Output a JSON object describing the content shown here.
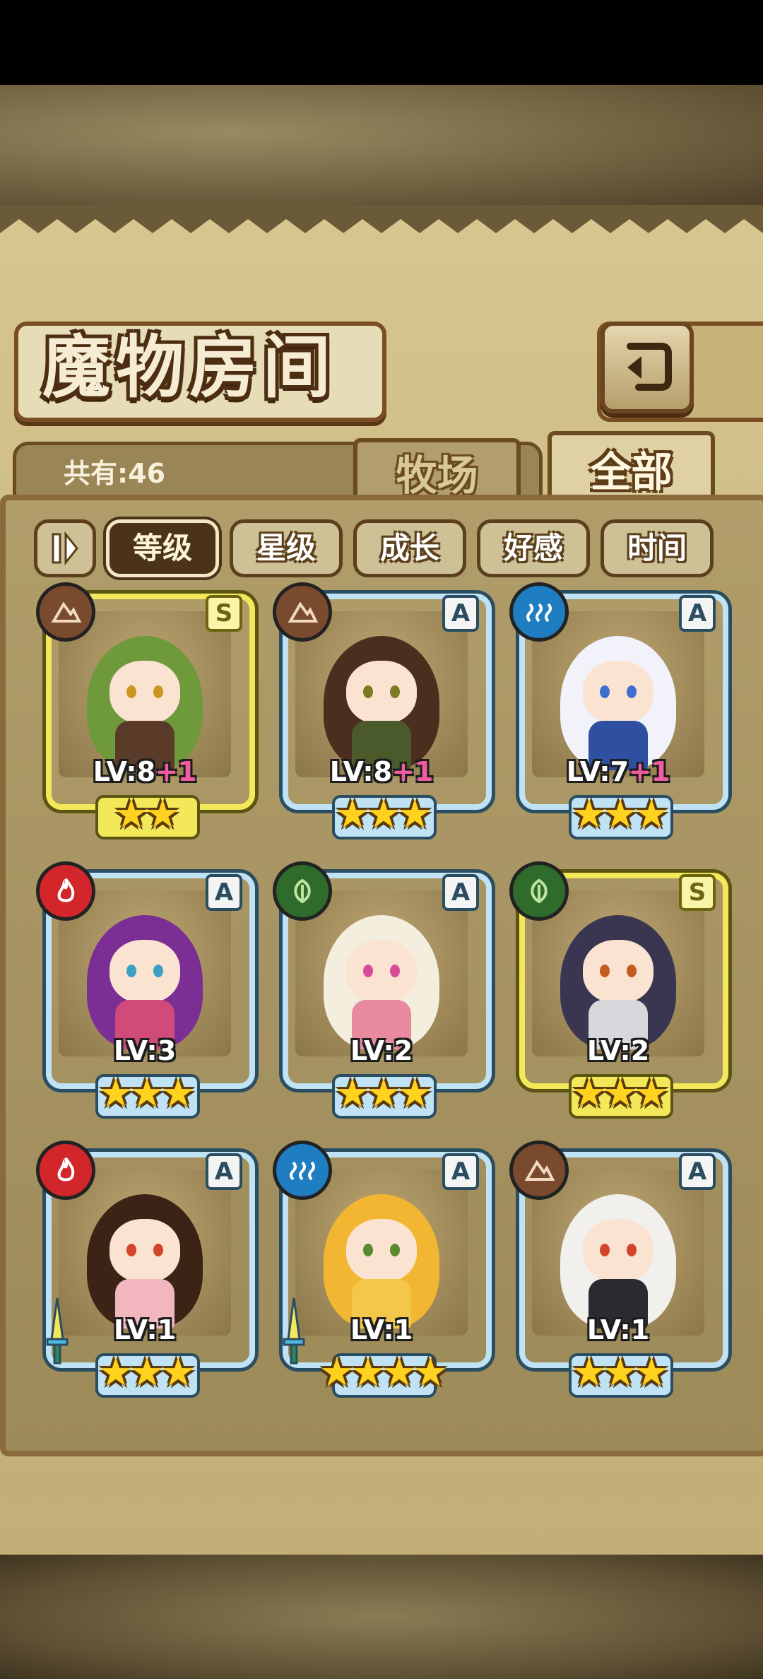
{
  "title": "魔物房间",
  "count_label": "共有:46",
  "tabs": [
    {
      "label": "牧场",
      "active": false
    },
    {
      "label": "全部",
      "active": true
    }
  ],
  "sort_buttons": [
    {
      "label": "等级",
      "active": true
    },
    {
      "label": "星级",
      "active": false
    },
    {
      "label": "成长",
      "active": false
    },
    {
      "label": "好感",
      "active": false
    },
    {
      "label": "时间",
      "active": false
    }
  ],
  "icons": {
    "back": "return-arrow-icon",
    "sort_toggle": "sort-order-icon"
  },
  "monsters": [
    {
      "rank": "S",
      "element": "earth",
      "lv": "LV:8",
      "plus": "+1",
      "stars": 2,
      "hair": "#6e9a3c",
      "cloth": "#5a3b2a",
      "eyes": "#c9961e"
    },
    {
      "rank": "A",
      "element": "earth",
      "lv": "LV:8",
      "plus": "+1",
      "stars": 3,
      "hair": "#4b2e1e",
      "cloth": "#4a5a2b",
      "eyes": "#7c7a22"
    },
    {
      "rank": "A",
      "element": "water",
      "lv": "LV:7",
      "plus": "+1",
      "stars": 3,
      "hair": "#f2f2fa",
      "cloth": "#2f4fa0",
      "eyes": "#3d6fd1"
    },
    {
      "rank": "A",
      "element": "fire",
      "lv": "LV:3",
      "plus": "",
      "stars": 3,
      "hair": "#7b2e93",
      "cloth": "#d04a7a",
      "eyes": "#3aa0c4"
    },
    {
      "rank": "A",
      "element": "wood",
      "lv": "LV:2",
      "plus": "",
      "stars": 3,
      "hair": "#f4eede",
      "cloth": "#e88aa0",
      "eyes": "#d84a9a"
    },
    {
      "rank": "S",
      "element": "wood",
      "lv": "LV:2",
      "plus": "",
      "stars": 3,
      "hair": "#3a3550",
      "cloth": "#d8d8dc",
      "eyes": "#c35a1e"
    },
    {
      "rank": "A",
      "element": "fire",
      "lv": "LV:1",
      "plus": "",
      "stars": 3,
      "hair": "#3b2316",
      "cloth": "#f1b6be",
      "eyes": "#d2452a"
    },
    {
      "rank": "A",
      "element": "water",
      "lv": "LV:1",
      "plus": "",
      "stars": 4,
      "hair": "#f2b632",
      "cloth": "#f3c84a",
      "eyes": "#5a8a2e"
    },
    {
      "rank": "A",
      "element": "earth",
      "lv": "LV:1",
      "plus": "",
      "stars": 3,
      "hair": "#f2f0ec",
      "cloth": "#2a2a30",
      "eyes": "#d2452a"
    }
  ],
  "equipped_flags": [
    false,
    false,
    false,
    false,
    false,
    false,
    true,
    true,
    false
  ]
}
